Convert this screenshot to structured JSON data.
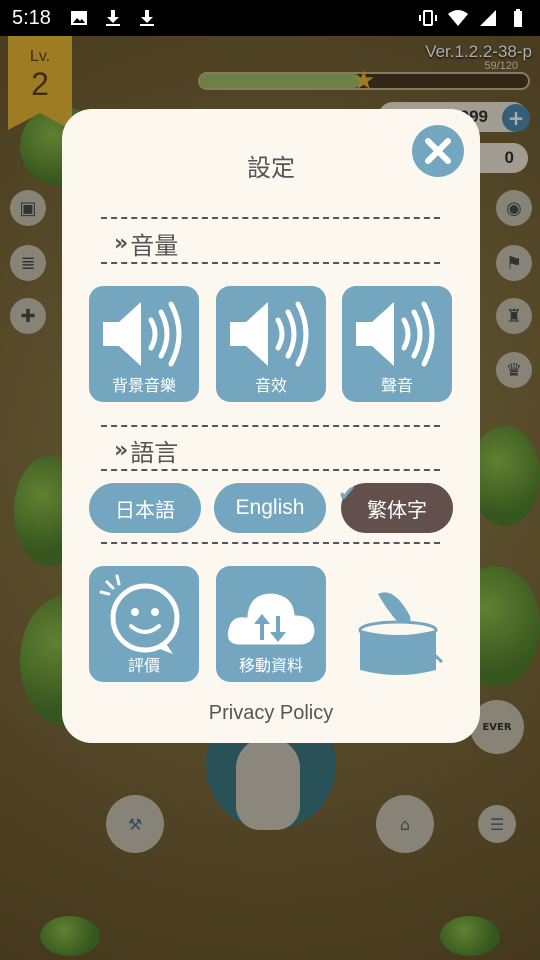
{
  "status_bar": {
    "time": "5:18",
    "left_icons": [
      "image-icon",
      "download-icon",
      "download-icon"
    ],
    "right_icons": [
      "vibrate-icon",
      "wifi-icon",
      "signal-icon",
      "battery-icon"
    ]
  },
  "game": {
    "level_label": "Lv.",
    "level_value": "2",
    "version": "Ver.1.2.2-38-p",
    "xp_text": "59/120",
    "xp_fraction": 0.49,
    "currency_1": "999",
    "currency_2": "0",
    "ever_badge": "EVER"
  },
  "dialog": {
    "title": "設定",
    "volume_section": "音量",
    "volume_tiles": [
      {
        "label": "背景音樂",
        "icon": "speaker-icon"
      },
      {
        "label": "音效",
        "icon": "speaker-icon"
      },
      {
        "label": "聲音",
        "icon": "speaker-icon"
      }
    ],
    "language_section": "語言",
    "languages": [
      {
        "label": "日本語",
        "selected": false
      },
      {
        "label": "English",
        "selected": false
      },
      {
        "label": "繁体字",
        "selected": true
      }
    ],
    "actions": [
      {
        "label": "評價",
        "icon": "smile-chat-icon"
      },
      {
        "label": "移動資料",
        "icon": "cloud-sync-icon"
      },
      {
        "label": "",
        "icon": "can-feather-icon"
      }
    ],
    "privacy_policy": "Privacy Policy"
  },
  "colors": {
    "tile_blue": "#74a6bf",
    "selected_brown": "#63504d",
    "dialog_bg": "#fcf8ef"
  }
}
